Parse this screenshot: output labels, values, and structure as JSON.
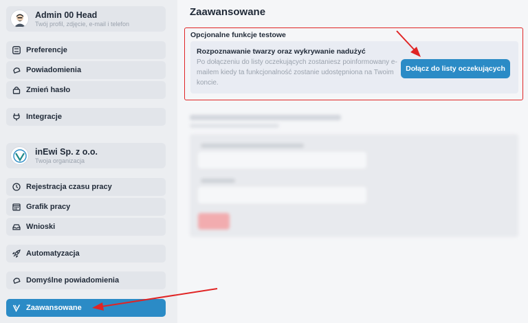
{
  "profile": {
    "name": "Admin 00 Head",
    "subtitle": "Twój profil, zdjęcie, e-mail i telefon"
  },
  "nav_group1": [
    {
      "label": "Preferencje",
      "icon": "sliders-icon"
    },
    {
      "label": "Powiadomienia",
      "icon": "bell-icon"
    },
    {
      "label": "Zmień hasło",
      "icon": "lock-icon"
    }
  ],
  "integrations": {
    "label": "Integracje",
    "icon": "plug-icon"
  },
  "organization": {
    "name": "inEwi Sp. z o.o.",
    "subtitle": "Twoja organizacja"
  },
  "nav_group2": [
    {
      "label": "Rejestracja czasu pracy",
      "icon": "clock-icon"
    },
    {
      "label": "Grafik pracy",
      "icon": "calendar-icon"
    },
    {
      "label": "Wnioski",
      "icon": "inbox-icon"
    }
  ],
  "automation": {
    "label": "Automatyzacja",
    "icon": "rocket-icon"
  },
  "default_notifications": {
    "label": "Domyślne powiadomienia",
    "icon": "bell-icon"
  },
  "advanced": {
    "label": "Zaawansowane",
    "icon": "advanced-icon",
    "active": true
  },
  "main": {
    "title": "Zaawansowane",
    "optional_features": {
      "heading": "Opcjonalne funkcje testowe",
      "feature_title": "Rozpoznawanie twarzy oraz wykrywanie nadużyć",
      "feature_description": "Po dołączeniu do listy oczekujących zostaniesz poinformowany e-mailem kiedy ta funkcjonalność zostanie udostępniona na Twoim koncie.",
      "join_button": "Dołącz do listy oczekujących"
    }
  },
  "colors": {
    "accent": "#2b8bc6",
    "highlight_border": "#e02424",
    "arrow": "#e02424"
  }
}
